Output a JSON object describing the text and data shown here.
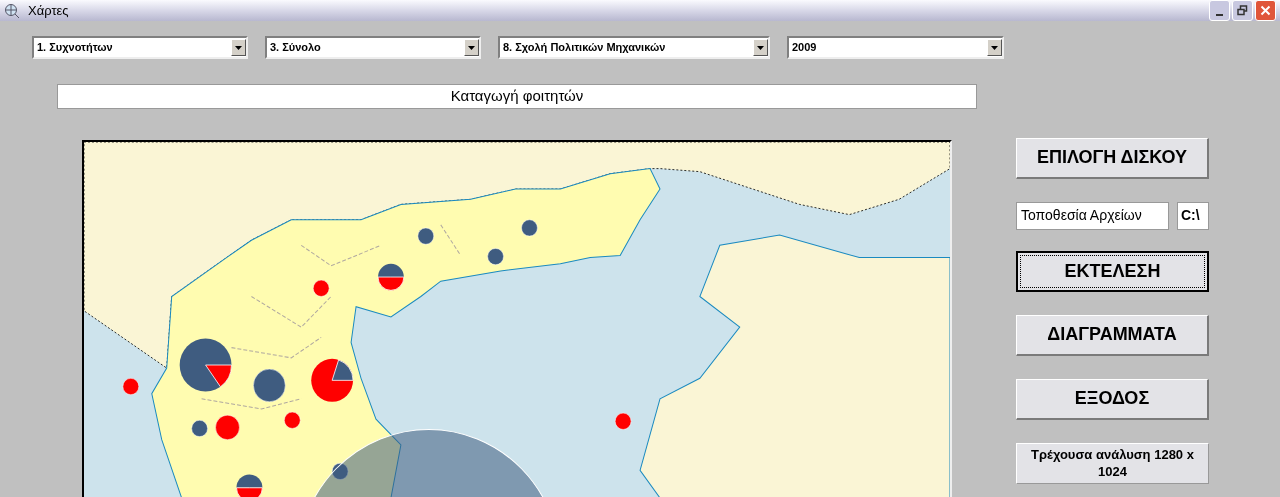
{
  "window": {
    "title": "Χάρτες"
  },
  "dropdowns": [
    {
      "value": "1. Συχνοτήτων"
    },
    {
      "value": "3. Σύνολο"
    },
    {
      "value": "8. Σχολή Πολιτικών Μηχανικών"
    },
    {
      "value": "2009"
    }
  ],
  "map_title": "Καταγωγή φοιτητών",
  "buttons": [
    {
      "label": "ΕΠΙΛΟΓΗ ΔΙΣΚΟΥ",
      "focused": false
    },
    {
      "label": "ΕΚΤΕΛΕΣΗ",
      "focused": true
    },
    {
      "label": "ΔΙΑΓΡΑΜΜΑΤΑ",
      "focused": false
    },
    {
      "label": "ΕΞΟΔΟΣ",
      "focused": false
    }
  ],
  "location": {
    "label": "Τοποθεσία Αρχείων",
    "value": "C:\\"
  },
  "resolution": "Τρέχουσα ανάλυση 1280 x  1024"
}
